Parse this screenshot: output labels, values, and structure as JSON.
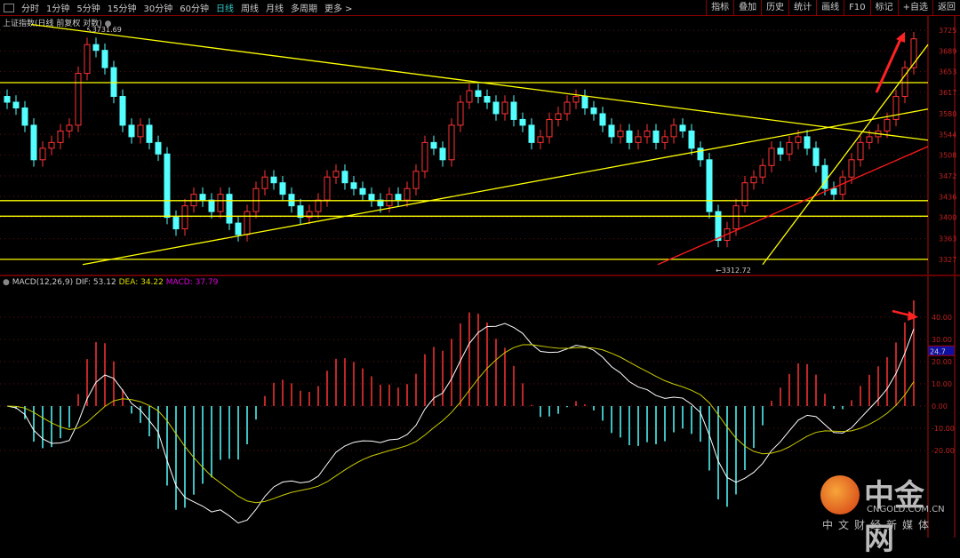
{
  "toolbar": {
    "periods": [
      "分时",
      "1分钟",
      "5分钟",
      "15分钟",
      "30分钟",
      "60分钟",
      "日线",
      "周线",
      "月线",
      "多周期",
      "更多 >"
    ],
    "active": "日线",
    "right": [
      "指标",
      "叠加",
      "历史",
      "统计",
      "画线",
      "F10",
      "标记",
      "+自选",
      "返回"
    ]
  },
  "title": "上证指数(日线 前复权 对数)",
  "annotations": {
    "high": "3731.69",
    "low": "3312.72"
  },
  "macd_label": {
    "name": "MACD(12,26,9)",
    "dif": "DIF: 53.12",
    "dea": "DEA: 34.22",
    "macd": "MACD: 37.79"
  },
  "logo": {
    "cn": "中金网",
    "en": "CNGOLD.COM.CN",
    "sub": "中文财经新媒体"
  },
  "colors": {
    "up": "#ff3333",
    "down": "#54ffff",
    "line": "#ffff00",
    "trend_red": "#ff1a1a",
    "axis": "#b01010",
    "dif": "#ffffff",
    "dea": "#cccc00"
  },
  "chart_data": [
    {
      "type": "candlestick",
      "title": "上证指数 日线",
      "y_ticks": [
        "3725",
        "3689",
        "3653",
        "3617",
        "3580",
        "3544",
        "3508",
        "3472",
        "3436",
        "3400",
        "3363",
        "3327"
      ],
      "ylim": [
        3310,
        3740
      ],
      "closes": [
        3600,
        3590,
        3560,
        3500,
        3520,
        3530,
        3550,
        3560,
        3650,
        3700,
        3690,
        3660,
        3610,
        3560,
        3540,
        3560,
        3530,
        3510,
        3400,
        3380,
        3420,
        3440,
        3430,
        3410,
        3440,
        3390,
        3370,
        3410,
        3450,
        3470,
        3460,
        3440,
        3420,
        3400,
        3410,
        3430,
        3470,
        3480,
        3460,
        3450,
        3440,
        3430,
        3420,
        3440,
        3430,
        3450,
        3480,
        3530,
        3520,
        3500,
        3560,
        3600,
        3620,
        3610,
        3600,
        3580,
        3600,
        3570,
        3560,
        3530,
        3540,
        3570,
        3580,
        3600,
        3610,
        3590,
        3580,
        3560,
        3540,
        3550,
        3530,
        3540,
        3550,
        3530,
        3540,
        3560,
        3550,
        3520,
        3500,
        3410,
        3360,
        3380,
        3420,
        3460,
        3470,
        3490,
        3520,
        3510,
        3530,
        3540,
        3520,
        3490,
        3450,
        3440,
        3470,
        3500,
        3530,
        3540,
        3550,
        3570,
        3610,
        3660,
        3710
      ],
      "trendlines": [
        {
          "color": "line",
          "from": [
            2.7,
            3735
          ],
          "to": [
            103.6,
            3534
          ]
        },
        {
          "color": "line",
          "from": [
            8.5,
            3318
          ],
          "to": [
            103.6,
            3588
          ]
        },
        {
          "color": "line",
          "from": [
            -1,
            3634
          ],
          "to": [
            103.6,
            3634
          ]
        },
        {
          "color": "line",
          "from": [
            -1,
            3429
          ],
          "to": [
            103.6,
            3429
          ]
        },
        {
          "color": "line",
          "from": [
            -1,
            3402
          ],
          "to": [
            103.6,
            3402
          ]
        },
        {
          "color": "line",
          "from": [
            -1,
            3327
          ],
          "to": [
            103.6,
            3327
          ]
        },
        {
          "color": "trend_red",
          "from": [
            73.2,
            3318
          ],
          "to": [
            103.6,
            3523
          ]
        },
        {
          "color": "line",
          "from": [
            85,
            3318
          ],
          "to": [
            103.6,
            3700
          ]
        }
      ]
    },
    {
      "type": "macd",
      "params": [
        12,
        26,
        9
      ],
      "y_ticks": [
        "40.00",
        "30.00",
        "20.00",
        "10.00",
        "0.00",
        "-10.00",
        "-20.00"
      ],
      "ylim": [
        -57,
        57
      ],
      "current_marker": "24.7",
      "last": {
        "dif": 53.12,
        "dea": 34.22,
        "macd": 37.79
      }
    }
  ]
}
